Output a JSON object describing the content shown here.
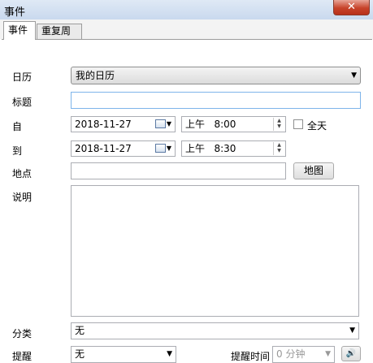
{
  "window": {
    "title": "事件",
    "close_glyph": "✕"
  },
  "tabs": [
    {
      "label": "事件",
      "active": true
    },
    {
      "label": "重复周期",
      "active": false
    }
  ],
  "form": {
    "calendar_label": "日历",
    "calendar_value": "我的日历",
    "title_label": "标题",
    "title_value": "",
    "from_label": "自",
    "from_date": "2018-11-27",
    "from_time": "上午   8:00",
    "allday_label": "全天",
    "allday_checked": false,
    "to_label": "到",
    "to_date": "2018-11-27",
    "to_time": "上午   8:30",
    "location_label": "地点",
    "location_value": "",
    "map_button": "地图",
    "desc_label": "说明",
    "desc_value": "",
    "category_label": "分类",
    "category_value": "无",
    "reminder_label": "提醒",
    "reminder_value": "无",
    "reminder_time_label": "提醒时间",
    "reminder_time_value": "0 分钟"
  },
  "icons": {
    "dropdown_arrow": "▼",
    "spin_up": "▲",
    "spin_down": "▼",
    "speaker": "🔊"
  },
  "colors": {
    "close_red": "#c7432a",
    "title_focus_border": "#7eb4ea"
  }
}
